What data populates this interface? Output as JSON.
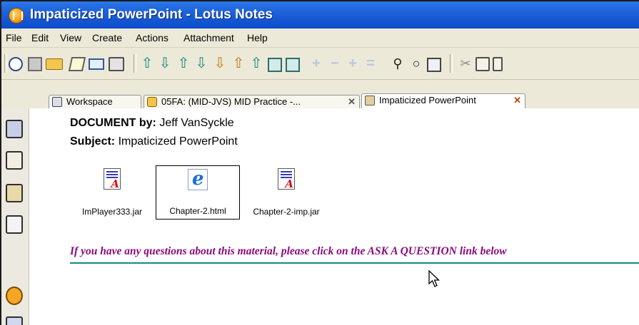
{
  "window": {
    "title": "Impaticized PowerPoint - Lotus Notes"
  },
  "menu": [
    "File",
    "Edit",
    "View",
    "Create",
    "Actions",
    "Attachment",
    "Help"
  ],
  "toolbar_icons": [
    "new-icon",
    "save-icon",
    "open-folder-icon",
    "edit-document-icon",
    "forward-icon",
    "print-icon",
    "arrow-up-icon",
    "arrow-down-icon",
    "arrow-up-outline-icon",
    "arrow-down-outline-icon",
    "star-down-icon",
    "star-up-icon",
    "view-pane-icon",
    "preview-icon",
    "expand-icon",
    "collapse-icon",
    "expand-all-icon",
    "collapse-all-icon",
    "binoculars-icon",
    "search-icon",
    "search-bar-icon",
    "cut-icon",
    "copy-icon",
    "paste-icon"
  ],
  "tabs": [
    {
      "label": "Workspace",
      "icon": "workspace-icon",
      "closable": false,
      "active": false
    },
    {
      "label": "05FA: (MID-JVS) MID Practice -...",
      "icon": "database-icon",
      "closable": true,
      "active": false
    },
    {
      "label": "Impaticized PowerPoint",
      "icon": "document-icon",
      "closable": true,
      "active": true
    }
  ],
  "sidebar_icons": [
    "mail-icon",
    "calendar-icon",
    "address-book-icon",
    "todo-icon",
    "replicator-icon"
  ],
  "document": {
    "author_label": "DOCUMENT by:",
    "author": "Jeff VanSyckle",
    "subject_label": "Subject:",
    "subject": "Impaticized PowerPoint",
    "attachments": [
      {
        "name": "ImPlayer333.jar",
        "icon": "jar-file-icon",
        "selected": false
      },
      {
        "name": "Chapter-2.html",
        "icon": "internet-explorer-icon",
        "selected": true
      },
      {
        "name": "Chapter-2-imp.jar",
        "icon": "jar-file-icon",
        "selected": false
      }
    ],
    "question_text": "If you have any questions about this material, please click on the  ASK A QUESTION link below"
  },
  "colors": {
    "titlebar": "#0b4ccc",
    "question_text": "#8b0a7a",
    "rule": "#0f8a86"
  }
}
